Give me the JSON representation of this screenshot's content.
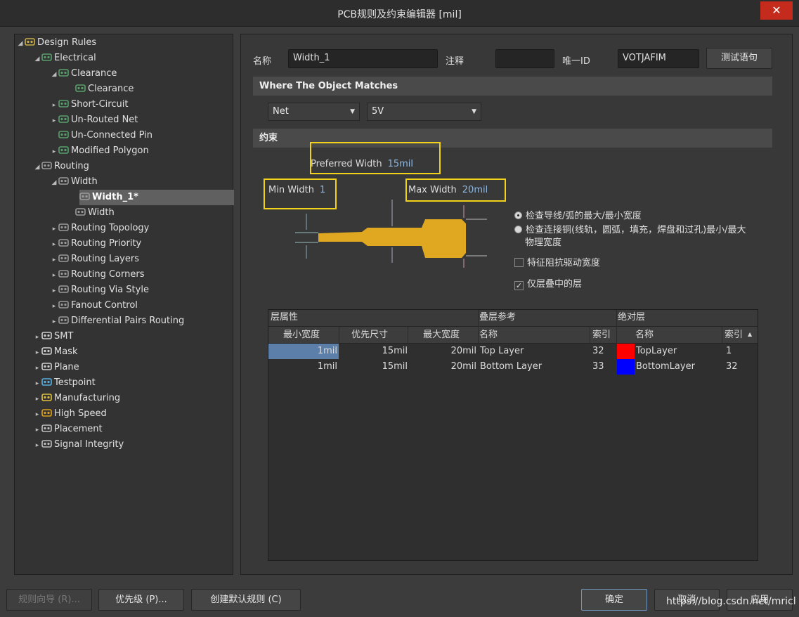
{
  "window": {
    "title": "PCB规则及约束编辑器 [mil]",
    "close": "✕"
  },
  "tree": [
    {
      "label": "Design Rules",
      "level": 0,
      "arrow": "◢",
      "icon": "design-rules-icon",
      "color": "#c9b04a"
    },
    {
      "label": "Electrical",
      "level": 1,
      "arrow": "◢",
      "icon": "electrical-icon",
      "color": "#59a06d"
    },
    {
      "label": "Clearance",
      "level": 2,
      "arrow": "◢",
      "icon": "clearance-icon",
      "color": "#59a06d"
    },
    {
      "label": "Clearance",
      "level": 3,
      "arrow": "",
      "icon": "clearance-rule-icon",
      "color": "#59a06d"
    },
    {
      "label": "Short-Circuit",
      "level": 2,
      "arrow": "▸",
      "icon": "short-circuit-icon",
      "color": "#59a06d"
    },
    {
      "label": "Un-Routed Net",
      "level": 2,
      "arrow": "▸",
      "icon": "unrouted-net-icon",
      "color": "#59a06d"
    },
    {
      "label": "Un-Connected Pin",
      "level": 2,
      "arrow": "",
      "icon": "unconnected-pin-icon",
      "color": "#59a06d"
    },
    {
      "label": "Modified Polygon",
      "level": 2,
      "arrow": "▸",
      "icon": "modified-polygon-icon",
      "color": "#59a06d"
    },
    {
      "label": "Routing",
      "level": 1,
      "arrow": "◢",
      "icon": "routing-icon",
      "color": "#9a9a9a"
    },
    {
      "label": "Width",
      "level": 2,
      "arrow": "◢",
      "icon": "width-icon",
      "color": "#9a9a9a"
    },
    {
      "label": "Width_1*",
      "level": 3,
      "arrow": "",
      "icon": "width-rule-icon",
      "color": "#9a9a9a",
      "selected": true
    },
    {
      "label": "Width",
      "level": 3,
      "arrow": "",
      "icon": "width-rule-icon",
      "color": "#9a9a9a"
    },
    {
      "label": "Routing Topology",
      "level": 2,
      "arrow": "▸",
      "icon": "routing-topology-icon",
      "color": "#9a9a9a"
    },
    {
      "label": "Routing Priority",
      "level": 2,
      "arrow": "▸",
      "icon": "routing-priority-icon",
      "color": "#9a9a9a"
    },
    {
      "label": "Routing Layers",
      "level": 2,
      "arrow": "▸",
      "icon": "routing-layers-icon",
      "color": "#9a9a9a"
    },
    {
      "label": "Routing Corners",
      "level": 2,
      "arrow": "▸",
      "icon": "routing-corners-icon",
      "color": "#9a9a9a"
    },
    {
      "label": "Routing Via Style",
      "level": 2,
      "arrow": "▸",
      "icon": "routing-via-style-icon",
      "color": "#9a9a9a"
    },
    {
      "label": "Fanout Control",
      "level": 2,
      "arrow": "▸",
      "icon": "fanout-control-icon",
      "color": "#9a9a9a"
    },
    {
      "label": "Differential Pairs Routing",
      "level": 2,
      "arrow": "▸",
      "icon": "diff-pairs-icon",
      "color": "#9a9a9a"
    },
    {
      "label": "SMT",
      "level": 1,
      "arrow": "▸",
      "icon": "smt-icon",
      "color": "#cfcfcf"
    },
    {
      "label": "Mask",
      "level": 1,
      "arrow": "▸",
      "icon": "mask-icon",
      "color": "#cfcfcf"
    },
    {
      "label": "Plane",
      "level": 1,
      "arrow": "▸",
      "icon": "plane-icon",
      "color": "#cfcfcf"
    },
    {
      "label": "Testpoint",
      "level": 1,
      "arrow": "▸",
      "icon": "testpoint-icon",
      "color": "#5ab0e0"
    },
    {
      "label": "Manufacturing",
      "level": 1,
      "arrow": "▸",
      "icon": "manufacturing-icon",
      "color": "#e0c040"
    },
    {
      "label": "High Speed",
      "level": 1,
      "arrow": "▸",
      "icon": "high-speed-icon",
      "color": "#e0a020"
    },
    {
      "label": "Placement",
      "level": 1,
      "arrow": "▸",
      "icon": "placement-icon",
      "color": "#bdbdbd"
    },
    {
      "label": "Signal Integrity",
      "level": 1,
      "arrow": "▸",
      "icon": "signal-integrity-icon",
      "color": "#bdbdbd"
    }
  ],
  "form": {
    "name_label": "名称",
    "name_value": "Width_1",
    "comment_label": "注释",
    "comment_value": "",
    "uid_label": "唯一ID",
    "uid_value": "VOTJAFIM",
    "test_button": "测试语句"
  },
  "match": {
    "section": "Where The Object Matches",
    "select1": "Net",
    "select2": "5V"
  },
  "constraints": {
    "section": "约束",
    "preferred_label": "Preferred Width",
    "preferred_value": "15mil",
    "min_label": "Min Width",
    "min_value": "1",
    "max_label": "Max Width",
    "max_value": "20mil",
    "trace_color": "#e0a820",
    "radio1": "检查导线/弧的最大/最小宽度",
    "radio2_line1": "检查连接铜(线轨，圆弧，填充，焊盘和过孔)最小/最大",
    "radio2_line2": "物理宽度",
    "check1": "特征阻抗驱动宽度",
    "check2": "仅层叠中的层",
    "check2_mark": "✓"
  },
  "table": {
    "group_headers": [
      "层属性",
      "叠层参考",
      "绝对层"
    ],
    "columns": [
      "最小宽度",
      "优先尺寸",
      "最大宽度",
      "名称",
      "索引",
      "名称",
      "索引"
    ],
    "rows": [
      {
        "min": "1mil",
        "pref": "15mil",
        "max": "20mil",
        "stack_name": "Top Layer",
        "stack_index": "32",
        "color": "#ff0000",
        "abs_name": "TopLayer",
        "abs_index": "1"
      },
      {
        "min": "1mil",
        "pref": "15mil",
        "max": "20mil",
        "stack_name": "Bottom Layer",
        "stack_index": "33",
        "color": "#0000ff",
        "abs_name": "BottomLayer",
        "abs_index": "32"
      }
    ]
  },
  "footer": {
    "wizard": "规则向导 (R)...",
    "priority": "优先级 (P)...",
    "create_default": "创建默认规则 (C)",
    "ok": "确定",
    "cancel": "取消",
    "apply": "应用",
    "watermark": "https://blog.csdn.net/mricl"
  }
}
